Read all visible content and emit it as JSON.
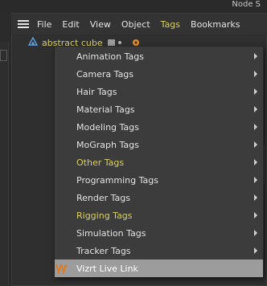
{
  "window": {
    "node_label": "Node S"
  },
  "menubar": {
    "items": [
      {
        "label": "File",
        "active": false
      },
      {
        "label": "Edit",
        "active": false
      },
      {
        "label": "View",
        "active": false
      },
      {
        "label": "Object",
        "active": false
      },
      {
        "label": "Tags",
        "active": true
      },
      {
        "label": "Bookmarks",
        "active": false
      }
    ]
  },
  "object_row": {
    "name": "abstract cube",
    "icon": "cube-null-icon"
  },
  "dropdown": {
    "items": [
      {
        "label": "Animation Tags",
        "submenu": true,
        "highlight_color": false
      },
      {
        "label": "Camera Tags",
        "submenu": true,
        "highlight_color": false
      },
      {
        "label": "Hair Tags",
        "submenu": true,
        "highlight_color": false
      },
      {
        "label": "Material Tags",
        "submenu": true,
        "highlight_color": false
      },
      {
        "label": "Modeling Tags",
        "submenu": true,
        "highlight_color": false
      },
      {
        "label": "MoGraph Tags",
        "submenu": true,
        "highlight_color": false
      },
      {
        "label": "Other Tags",
        "submenu": true,
        "highlight_color": true
      },
      {
        "label": "Programming Tags",
        "submenu": true,
        "highlight_color": false
      },
      {
        "label": "Render Tags",
        "submenu": true,
        "highlight_color": false
      },
      {
        "label": "Rigging Tags",
        "submenu": true,
        "highlight_color": true
      },
      {
        "label": "Simulation Tags",
        "submenu": true,
        "highlight_color": false
      },
      {
        "label": "Tracker Tags",
        "submenu": true,
        "highlight_color": false
      },
      {
        "label": "Vizrt Live Link",
        "submenu": false,
        "hovered": true,
        "icon": "vizrt-icon"
      }
    ]
  },
  "colors": {
    "accent_yellow": "#d8cf6a",
    "hover_bg": "#9c9c9c",
    "menu_bg": "#3c3c3c"
  }
}
